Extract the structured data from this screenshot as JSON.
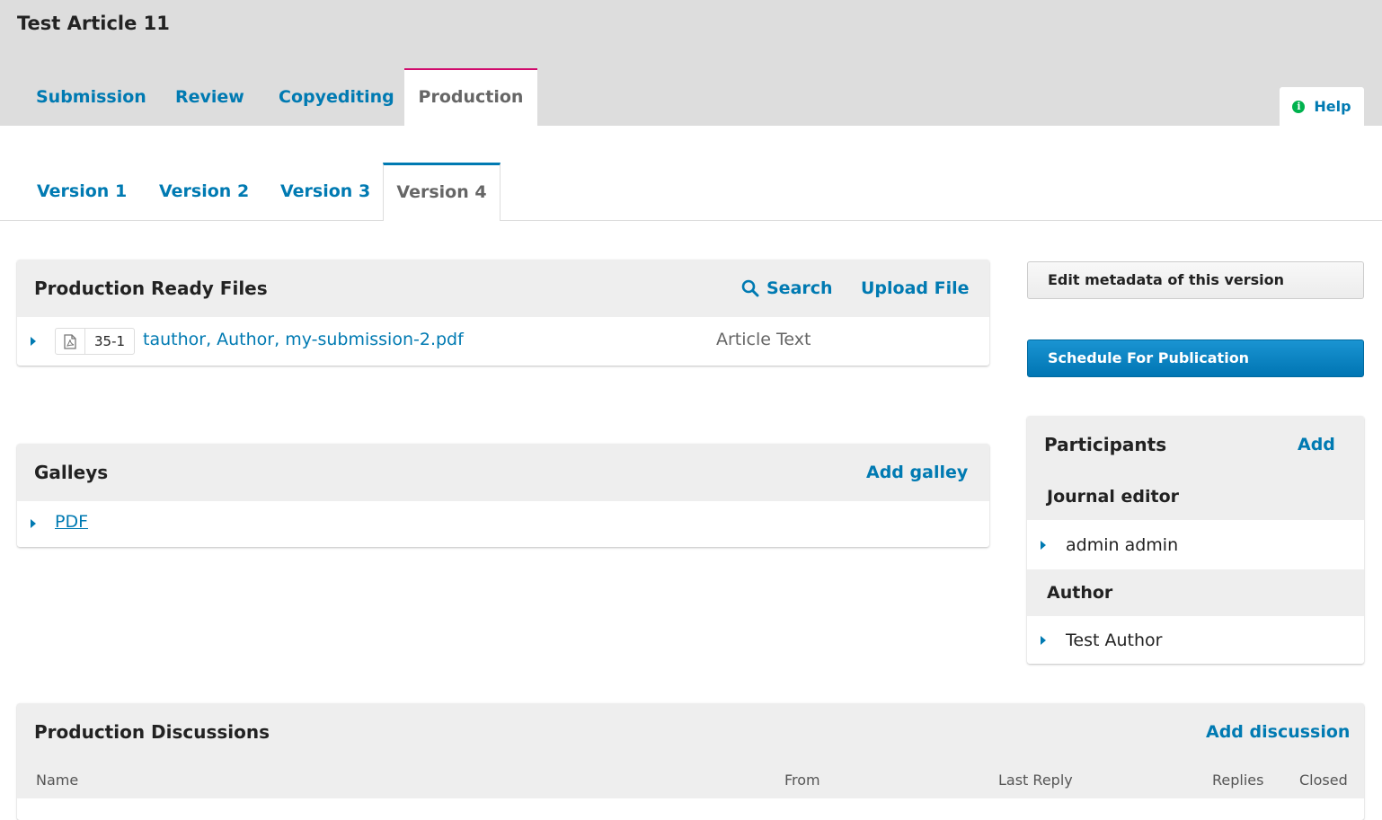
{
  "header": {
    "article_title": "Test Article 11",
    "stage_tabs": [
      {
        "label": "Submission"
      },
      {
        "label": "Review"
      },
      {
        "label": "Copyediting"
      },
      {
        "label": "Production"
      }
    ],
    "active_stage": "Production",
    "help_label": "Help"
  },
  "versions": {
    "tabs": [
      {
        "label": "Version 1"
      },
      {
        "label": "Version 2"
      },
      {
        "label": "Version 3"
      },
      {
        "label": "Version 4"
      }
    ],
    "active": "Version 4"
  },
  "production_files": {
    "title": "Production Ready Files",
    "search_label": "Search",
    "upload_label": "Upload File",
    "files": [
      {
        "id": "35-1",
        "name": "tauthor, Author, my-submission-2.pdf",
        "genre": "Article Text"
      }
    ]
  },
  "galleys": {
    "title": "Galleys",
    "add_label": "Add galley",
    "items": [
      {
        "label": "PDF"
      }
    ]
  },
  "sidebar": {
    "edit_metadata_label": "Edit metadata of this version",
    "schedule_label": "Schedule For Publication",
    "participants": {
      "title": "Participants",
      "add_label": "Add",
      "groups": [
        {
          "role": "Journal editor",
          "members": [
            "admin admin"
          ]
        },
        {
          "role": "Author",
          "members": [
            "Test Author"
          ]
        }
      ]
    }
  },
  "discussions": {
    "title": "Production Discussions",
    "add_label": "Add discussion",
    "columns": [
      "Name",
      "From",
      "Last Reply",
      "Replies",
      "Closed"
    ]
  },
  "colors": {
    "link": "#007ab2",
    "active_stage_border": "#d00a6c",
    "active_version_border": "#007ab2",
    "primary_button": "#0075b3",
    "help_icon": "#00b24e"
  }
}
